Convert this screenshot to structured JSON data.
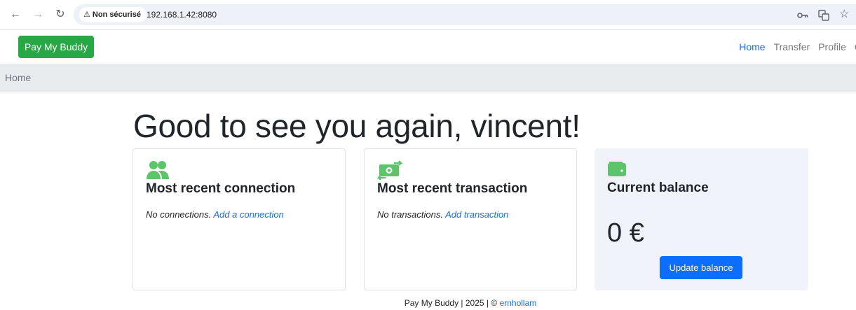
{
  "browser": {
    "security_label": "Non sécurisé",
    "url": "192.168.1.42:8080"
  },
  "navbar": {
    "brand": "Pay My Buddy",
    "links": [
      {
        "label": "Home",
        "active": true
      },
      {
        "label": "Transfer",
        "active": false
      },
      {
        "label": "Profile",
        "active": false
      },
      {
        "label": "C",
        "active": false
      }
    ]
  },
  "breadcrumb": {
    "current": "Home"
  },
  "greeting": "Good to see you again, vincent!",
  "cards": {
    "connection": {
      "title": "Most recent connection",
      "empty_text": "No connections.",
      "link_text": "Add a connection"
    },
    "transaction": {
      "title": "Most recent transaction",
      "empty_text": "No transactions.",
      "link_text": "Add transaction"
    },
    "balance": {
      "title": "Current balance",
      "value": "0 €",
      "button_label": "Update balance"
    }
  },
  "footer": {
    "text": "Pay My Buddy | 2025 | ©",
    "author": "ernhollam"
  },
  "colors": {
    "brand_green": "#28a745",
    "icon_green": "#5cc569",
    "link_blue": "#0d6efd",
    "breadcrumb_bg": "#e9ecef",
    "balance_card_bg": "#f0f3f9"
  }
}
